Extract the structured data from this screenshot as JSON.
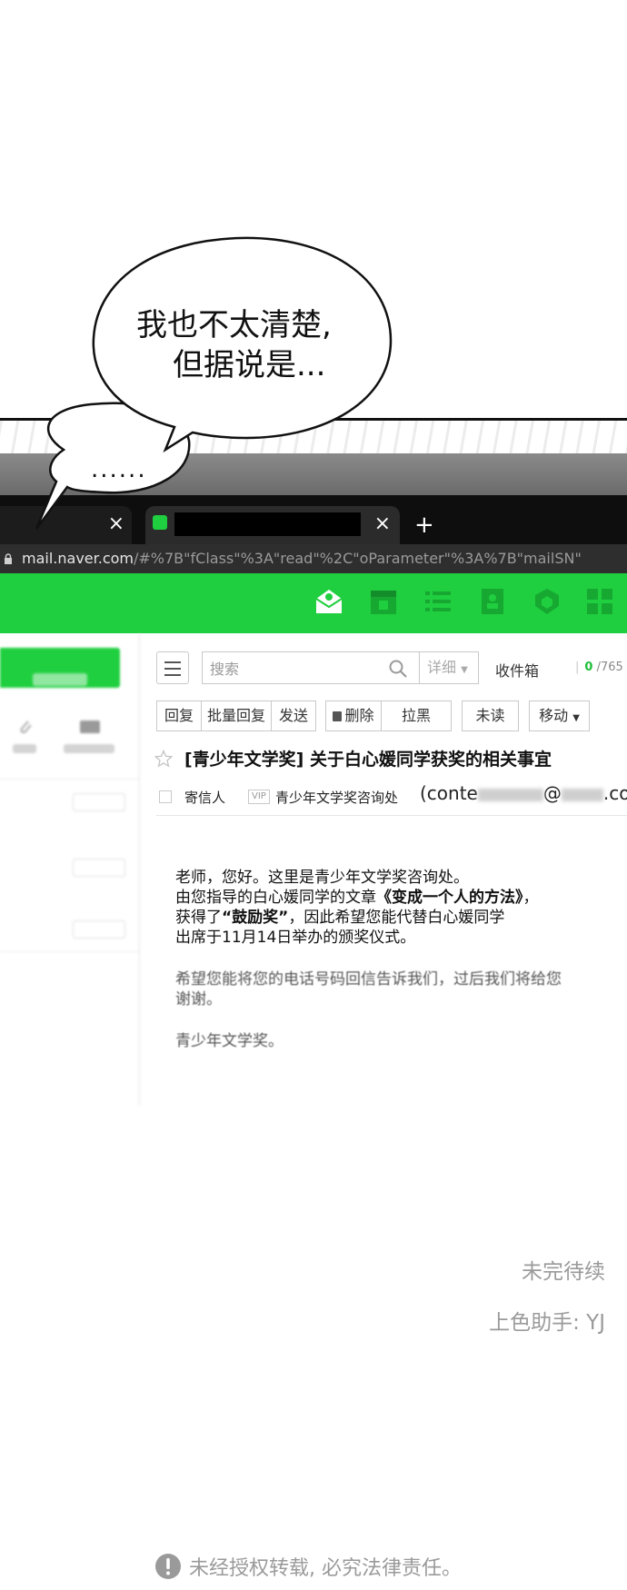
{
  "colors": {
    "brand_green": "#1fcf3f",
    "unread_green": "#1fbf3a",
    "footer_gray": "#9a9a9a"
  },
  "bubbles": {
    "main_line1": "我也不太清楚,",
    "main_line2": "但据说是...",
    "small": "......"
  },
  "browser": {
    "url_domain": "mail.naver.com",
    "url_rest": "/#%7B\"fClass\"%3A\"read\"%2C\"oParameter\"%3A%7B\"mailSN\"",
    "tab_close_glyph": "×",
    "new_tab_glyph": "+"
  },
  "mail": {
    "header_icons": [
      "mail-home-icon",
      "calendar-icon",
      "list-icon",
      "contacts-icon",
      "shield-icon",
      "grid-icon"
    ],
    "toolbar": {
      "search_placeholder": "搜索",
      "detail": "详细",
      "folder": "收件箱",
      "unread_count": "0",
      "total_count": "/765",
      "reply": "回复",
      "reply_all": "批量回复",
      "forward": "发送",
      "delete": "删除",
      "block": "拉黑",
      "mark_unread": "未读",
      "move": "移动"
    },
    "subject": "[青少年文学奖] 关于白心媛同学获奖的相关事宜",
    "sender_label": "寄信人",
    "vip": "VIP",
    "sender_name": "青少年文学奖咨询处",
    "sender_email_start": "(conte",
    "sender_email_at": "@",
    "sender_email_end": ".com",
    "body": {
      "line1": "老师，您好。这里是青少年文学奖咨询处。",
      "line2_pre": "由您指导的白心媛同学的文章",
      "line2_title": "《变成一个人的方法》",
      "line2_post": "，",
      "line3_pre": "获得了",
      "line3_award": "“鼓励奖”",
      "line3_post": "，因此希望您能代替白心媛同学",
      "line4": "出席于11月14日举办的颁奖仪式。",
      "line5": "希望您能将您的电话号码回信告诉我们，过后我们将给您",
      "line6": "谢谢。",
      "line7": "青少年文学奖。"
    }
  },
  "footer": {
    "to_be_continued": "未完待续",
    "color_assistant": "上色助手: YJ",
    "notice": "未经授权转载, 必究法律责任。"
  }
}
